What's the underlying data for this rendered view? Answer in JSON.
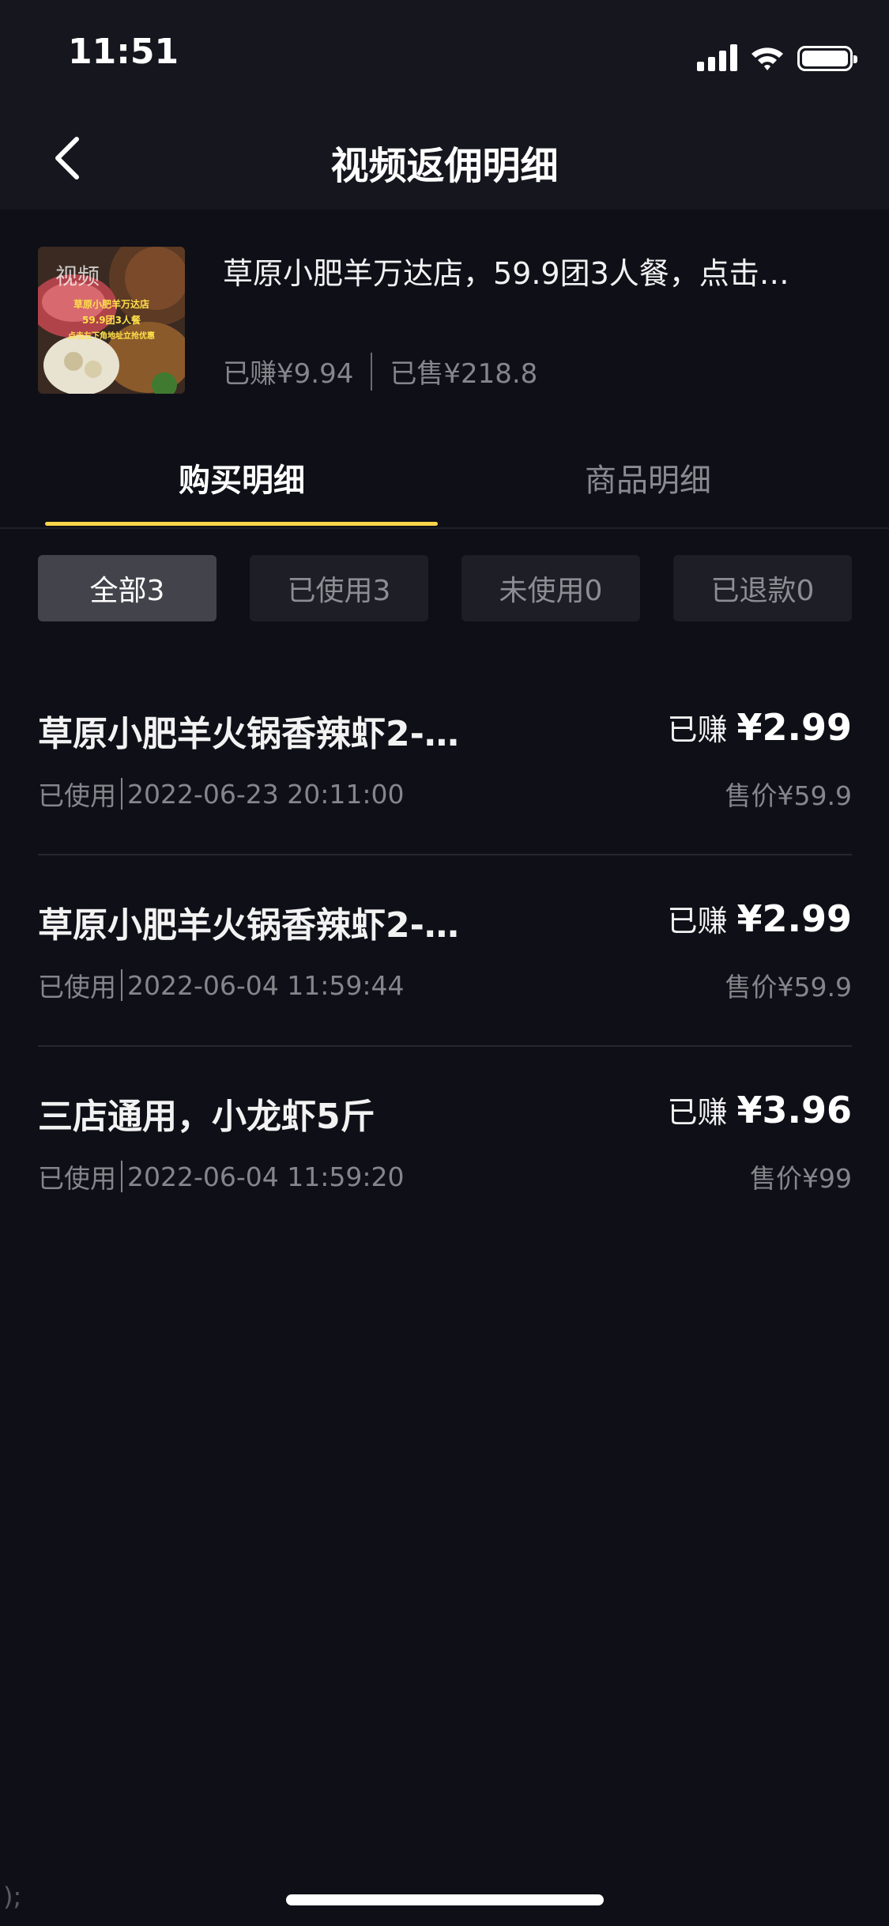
{
  "status_bar": {
    "time": "11:51"
  },
  "nav": {
    "title": "视频返佣明细"
  },
  "product": {
    "title": "草原小肥羊万达店，59.9团3人餐，点击…",
    "earned": "已赚¥9.94",
    "sold": "已售¥218.8",
    "thumbnail": {
      "watermark": "视频",
      "lines": [
        "草原小肥羊万达店",
        "59.9团3人餐",
        "点击左下角地址立抢优惠"
      ]
    }
  },
  "tabs": [
    {
      "label": "购买明细",
      "active": true
    },
    {
      "label": "商品明细",
      "active": false
    }
  ],
  "filters": [
    {
      "label": "全部3",
      "active": true
    },
    {
      "label": "已使用3",
      "active": false
    },
    {
      "label": "未使用0",
      "active": false
    },
    {
      "label": "已退款0",
      "active": false
    }
  ],
  "orders": [
    {
      "title": "草原小肥羊火锅香辣虾2-…",
      "earned_label": "已赚",
      "earned_value": "¥2.99",
      "status": "已使用",
      "datetime": "2022-06-23 20:11:00",
      "price": "售价¥59.9"
    },
    {
      "title": "草原小肥羊火锅香辣虾2-…",
      "earned_label": "已赚",
      "earned_value": "¥2.99",
      "status": "已使用",
      "datetime": "2022-06-04 11:59:44",
      "price": "售价¥59.9"
    },
    {
      "title": "三店通用，小龙虾5斤",
      "earned_label": "已赚",
      "earned_value": "¥3.96",
      "status": "已使用",
      "datetime": "2022-06-04 11:59:20",
      "price": "售价¥99"
    }
  ],
  "misc": {
    "corner_mark": ");"
  },
  "colors": {
    "background": "#0f0f17",
    "header": "#16161e",
    "accent": "#ffd54a",
    "muted_text": "#85858b"
  }
}
